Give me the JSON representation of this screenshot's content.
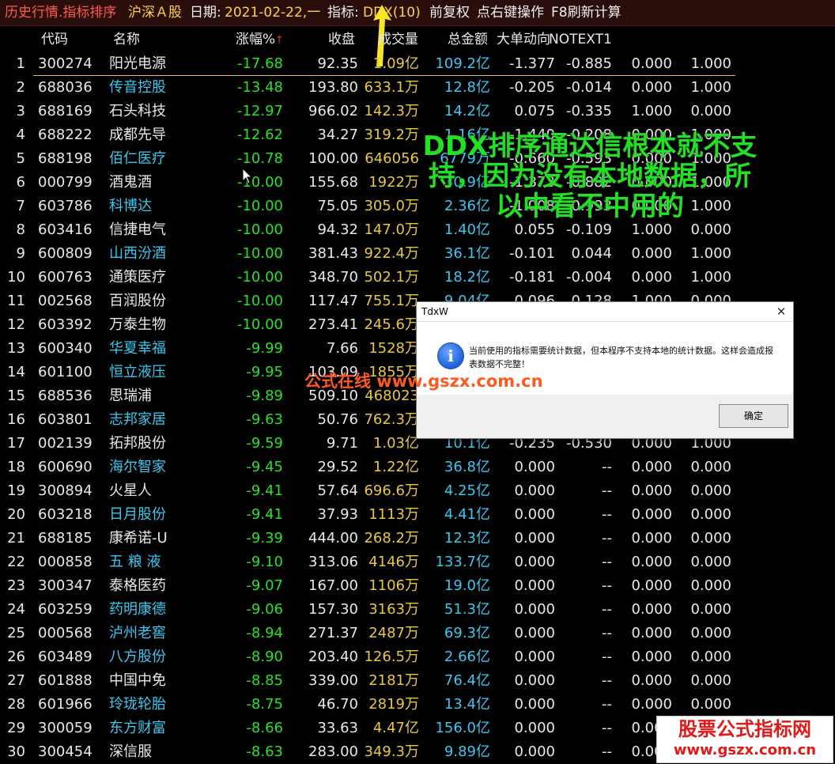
{
  "topbar": {
    "title": "历史行情.指标排序",
    "market": "沪深Ａ股",
    "date_label": "日期:",
    "date_value": "2021-02-22,一",
    "indicator_label": "指标:",
    "indicator_value": "DDX(10)",
    "adjust": "前复权",
    "hint_right_click": "点右键操作",
    "hint_f8": "F8刷新计算"
  },
  "columns": {
    "code": "代码",
    "name": "名称",
    "change": "涨幅%",
    "close": "收盘",
    "volume": "成交量",
    "amount": "总金额",
    "big_order": "大单动向",
    "notext1": "NOTEXT1"
  },
  "rows": [
    {
      "idx": "1",
      "code": "300274",
      "name": "阳光电源",
      "name_color": "w",
      "chg": "-17.68",
      "close": "92.35",
      "vol": "1.09亿",
      "amt": "109.2亿",
      "big": "-1.377",
      "nt1": "-0.885",
      "e1": "0.000",
      "e2": "1.000"
    },
    {
      "idx": "2",
      "code": "688036",
      "name": "传音控股",
      "name_color": "c",
      "chg": "-13.48",
      "close": "193.80",
      "vol": "633.1万",
      "amt": "12.8亿",
      "big": "-0.205",
      "nt1": "-0.014",
      "e1": "0.000",
      "e2": "1.000"
    },
    {
      "idx": "3",
      "code": "688169",
      "name": "石头科技",
      "name_color": "w",
      "chg": "-12.97",
      "close": "966.02",
      "vol": "142.3万",
      "amt": "14.2亿",
      "big": "0.075",
      "nt1": "-0.335",
      "e1": "1.000",
      "e2": "0.000"
    },
    {
      "idx": "4",
      "code": "688222",
      "name": "成都先导",
      "name_color": "w",
      "chg": "-12.62",
      "close": "34.27",
      "vol": "319.2万",
      "amt": "1.16亿",
      "big": "-1.440",
      "nt1": "-0.208",
      "e1": "0.000",
      "e2": "1.000"
    },
    {
      "idx": "5",
      "code": "688198",
      "name": "佰仁医疗",
      "name_color": "c",
      "chg": "-10.78",
      "close": "100.00",
      "vol": "646056",
      "amt": "6779万",
      "big": "-0.660",
      "nt1": "-0.593",
      "e1": "0.000",
      "e2": "1.000"
    },
    {
      "idx": "6",
      "code": "000799",
      "name": "酒鬼酒",
      "name_color": "w",
      "chg": "-10.00",
      "close": "155.68",
      "vol": "1922万",
      "amt": "30.9亿",
      "big": "-1.373",
      "nt1": "-0.882",
      "e1": "0.000",
      "e2": "1.000"
    },
    {
      "idx": "7",
      "code": "603786",
      "name": "科博达",
      "name_color": "c",
      "chg": "-10.00",
      "close": "75.05",
      "vol": "305.0万",
      "amt": "2.36亿",
      "big": "-1.008",
      "nt1": "-0.993",
      "e1": "0.000",
      "e2": "1.000"
    },
    {
      "idx": "8",
      "code": "603416",
      "name": "信捷电气",
      "name_color": "w",
      "chg": "-10.00",
      "close": "94.32",
      "vol": "147.0万",
      "amt": "1.40亿",
      "big": "0.055",
      "nt1": "-0.109",
      "e1": "1.000",
      "e2": "0.000"
    },
    {
      "idx": "9",
      "code": "600809",
      "name": "山西汾酒",
      "name_color": "c",
      "chg": "-10.00",
      "close": "381.43",
      "vol": "922.4万",
      "amt": "36.1亿",
      "big": "-0.101",
      "nt1": "0.044",
      "e1": "0.000",
      "e2": "1.000"
    },
    {
      "idx": "10",
      "code": "600763",
      "name": "通策医疗",
      "name_color": "w",
      "chg": "-10.00",
      "close": "348.70",
      "vol": "502.1万",
      "amt": "18.2亿",
      "big": "-0.181",
      "nt1": "-0.004",
      "e1": "0.000",
      "e2": "1.000"
    },
    {
      "idx": "11",
      "code": "002568",
      "name": "百润股份",
      "name_color": "w",
      "chg": "-10.00",
      "close": "117.47",
      "vol": "755.1万",
      "amt": "9.04亿",
      "big": "0.096",
      "nt1": "0.128",
      "e1": "1.000",
      "e2": "0.000"
    },
    {
      "idx": "12",
      "code": "603392",
      "name": "万泰生物",
      "name_color": "w",
      "chg": "-10.00",
      "close": "273.41",
      "vol": "245.6万",
      "amt": "",
      "big": "",
      "nt1": "",
      "e1": "",
      "e2": ""
    },
    {
      "idx": "13",
      "code": "600340",
      "name": "华夏幸福",
      "name_color": "c",
      "chg": "-9.99",
      "close": "7.66",
      "vol": "1528万",
      "amt": "",
      "big": "",
      "nt1": "",
      "e1": "",
      "e2": ""
    },
    {
      "idx": "14",
      "code": "601100",
      "name": "恒立液压",
      "name_color": "c",
      "chg": "-9.95",
      "close": "103.09",
      "vol": "1855万",
      "amt": "",
      "big": "",
      "nt1": "",
      "e1": "",
      "e2": ""
    },
    {
      "idx": "15",
      "code": "688536",
      "name": "思瑞浦",
      "name_color": "w",
      "chg": "-9.89",
      "close": "509.10",
      "vol": "468023",
      "amt": "",
      "big": "",
      "nt1": "",
      "e1": "",
      "e2": ""
    },
    {
      "idx": "16",
      "code": "603801",
      "name": "志邦家居",
      "name_color": "c",
      "chg": "-9.63",
      "close": "50.76",
      "vol": "762.3万",
      "amt": "",
      "big": "",
      "nt1": "",
      "e1": "",
      "e2": ""
    },
    {
      "idx": "17",
      "code": "002139",
      "name": "拓邦股份",
      "name_color": "w",
      "chg": "-9.59",
      "close": "9.71",
      "vol": "1.03亿",
      "amt": "10.1亿",
      "big": "-0.235",
      "nt1": "-0.530",
      "e1": "0.000",
      "e2": "1.000"
    },
    {
      "idx": "18",
      "code": "600690",
      "name": "海尔智家",
      "name_color": "c",
      "chg": "-9.45",
      "close": "29.52",
      "vol": "1.22亿",
      "amt": "36.8亿",
      "big": "0.000",
      "nt1": "--",
      "e1": "0.000",
      "e2": "0.000"
    },
    {
      "idx": "19",
      "code": "300894",
      "name": "火星人",
      "name_color": "w",
      "chg": "-9.41",
      "close": "57.64",
      "vol": "696.6万",
      "amt": "4.25亿",
      "big": "0.000",
      "nt1": "--",
      "e1": "0.000",
      "e2": "0.000"
    },
    {
      "idx": "20",
      "code": "603218",
      "name": "日月股份",
      "name_color": "c",
      "chg": "-9.41",
      "close": "37.93",
      "vol": "1113万",
      "amt": "4.41亿",
      "big": "0.000",
      "nt1": "--",
      "e1": "0.000",
      "e2": "0.000"
    },
    {
      "idx": "21",
      "code": "688185",
      "name": "康希诺-U",
      "name_color": "w",
      "chg": "-9.39",
      "close": "444.00",
      "vol": "268.2万",
      "amt": "12.3亿",
      "big": "0.000",
      "nt1": "--",
      "e1": "0.000",
      "e2": "0.000"
    },
    {
      "idx": "22",
      "code": "000858",
      "name": "五 粮 液",
      "name_color": "c",
      "chg": "-9.10",
      "close": "313.06",
      "vol": "4146万",
      "amt": "133.7亿",
      "big": "0.000",
      "nt1": "--",
      "e1": "0.000",
      "e2": "0.000"
    },
    {
      "idx": "23",
      "code": "300347",
      "name": "泰格医药",
      "name_color": "w",
      "chg": "-9.07",
      "close": "167.00",
      "vol": "1106万",
      "amt": "19.0亿",
      "big": "0.000",
      "nt1": "--",
      "e1": "0.000",
      "e2": "0.000"
    },
    {
      "idx": "24",
      "code": "603259",
      "name": "药明康德",
      "name_color": "c",
      "chg": "-9.06",
      "close": "157.30",
      "vol": "3163万",
      "amt": "51.3亿",
      "big": "0.000",
      "nt1": "--",
      "e1": "0.000",
      "e2": "0.000"
    },
    {
      "idx": "25",
      "code": "000568",
      "name": "泸州老窖",
      "name_color": "c",
      "chg": "-8.94",
      "close": "271.37",
      "vol": "2487万",
      "amt": "69.3亿",
      "big": "0.000",
      "nt1": "--",
      "e1": "0.000",
      "e2": "0.000"
    },
    {
      "idx": "26",
      "code": "603489",
      "name": "八方股份",
      "name_color": "c",
      "chg": "-8.90",
      "close": "203.40",
      "vol": "126.5万",
      "amt": "2.66亿",
      "big": "0.000",
      "nt1": "--",
      "e1": "0.000",
      "e2": "0.000"
    },
    {
      "idx": "27",
      "code": "601888",
      "name": "中国中免",
      "name_color": "w",
      "chg": "-8.85",
      "close": "339.00",
      "vol": "2181万",
      "amt": "76.4亿",
      "big": "0.000",
      "nt1": "--",
      "e1": "0.000",
      "e2": "0.000"
    },
    {
      "idx": "28",
      "code": "601966",
      "name": "玲珑轮胎",
      "name_color": "c",
      "chg": "-8.75",
      "close": "46.70",
      "vol": "2819万",
      "amt": "13.4亿",
      "big": "0.000",
      "nt1": "--",
      "e1": "0.000",
      "e2": "0.000"
    },
    {
      "idx": "29",
      "code": "300059",
      "name": "东方财富",
      "name_color": "c",
      "chg": "-8.66",
      "close": "33.63",
      "vol": "4.47亿",
      "amt": "156.0亿",
      "big": "0.000",
      "nt1": "--",
      "e1": "0.000",
      "e2": "0.000"
    },
    {
      "idx": "30",
      "code": "300454",
      "name": "深信服",
      "name_color": "w",
      "chg": "-8.63",
      "close": "283.00",
      "vol": "349.3万",
      "amt": "9.89亿",
      "big": "0.000",
      "nt1": "--",
      "e1": "0.000",
      "e2": "0.000"
    }
  ],
  "annotation": {
    "line1": "DDX排序通达信根本就不支",
    "line2": "持，因为没有本地数据，所",
    "line3": "以中看不中用的"
  },
  "watermark_mid": "公式在线  www.gszx.com.cn",
  "dialog": {
    "title": "TdxW",
    "message": "当前使用的指标需要统计数据，但本程序不支持本地的统计数据。这样会造成报表数据不完整！",
    "ok_label": "确定",
    "icon": "info-icon"
  },
  "corner_logo": {
    "line1": "股票公式指标网",
    "line2": "www.gszx.com.cn"
  },
  "colors": {
    "down_green": "#28e028",
    "volume_yellow": "#e8c840",
    "amount_cyan": "#38c8f0",
    "title_red": "#ff5a4a",
    "annotation_green": "#24e024"
  }
}
